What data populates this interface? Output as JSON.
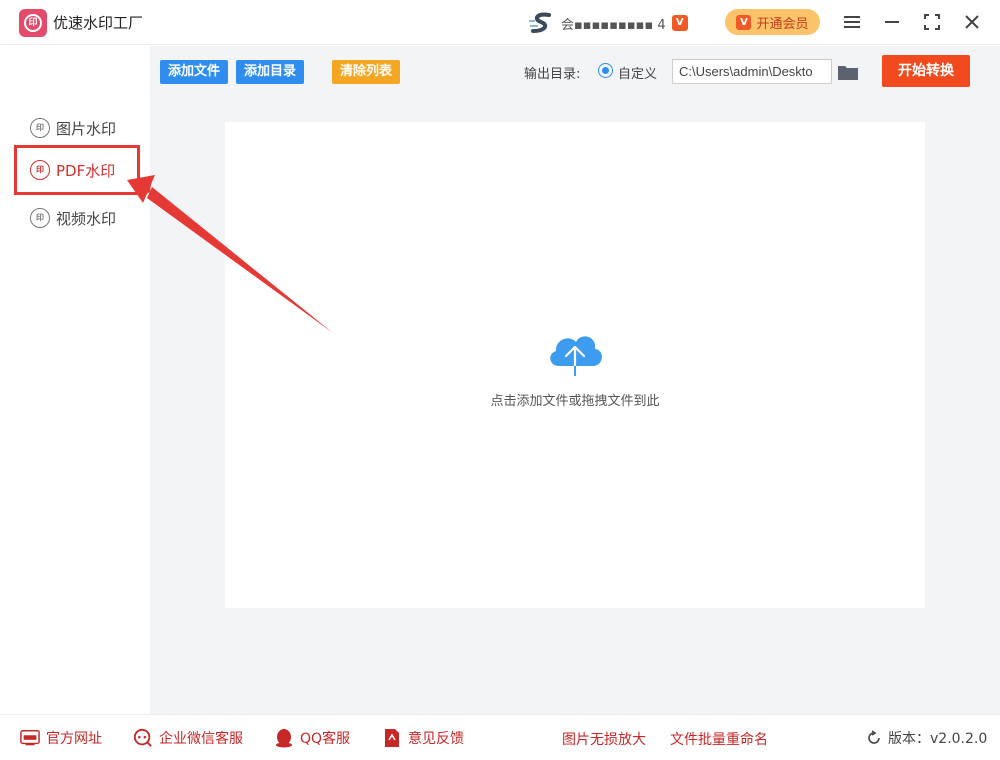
{
  "app": {
    "title": "优速水印工厂"
  },
  "header": {
    "user_name": "会▪▪▪▪▪▪▪▪▪ 4",
    "vip_button_label": "开通会员",
    "vip_badge": "V"
  },
  "sidebar": {
    "items": [
      {
        "label": "图片水印",
        "icon": "seal-icon",
        "active": false
      },
      {
        "label": "PDF水印",
        "icon": "seal-icon",
        "active": true
      },
      {
        "label": "视频水印",
        "icon": "seal-icon",
        "active": false
      }
    ]
  },
  "toolbar": {
    "add_file_label": "添加文件",
    "add_dir_label": "添加目录",
    "clear_list_label": "清除列表",
    "output_dir_label": "输出目录:",
    "custom_label": "自定义",
    "output_path": "C:\\Users\\admin\\Deskto",
    "start_label": "开始转换"
  },
  "dropzone": {
    "hint": "点击添加文件或拖拽文件到此"
  },
  "footer": {
    "website_label": "官方网址",
    "wechat_label": "企业微信客服",
    "qq_label": "QQ客服",
    "feedback_label": "意见反馈",
    "image_enlarge_label": "图片无损放大",
    "batch_rename_label": "文件批量重命名",
    "version_label": "版本：v2.0.2.0"
  },
  "colors": {
    "primary_blue": "#2f8df0",
    "accent_orange": "#f5a623",
    "start_red": "#f04a1e",
    "highlight_red": "#e53935"
  }
}
